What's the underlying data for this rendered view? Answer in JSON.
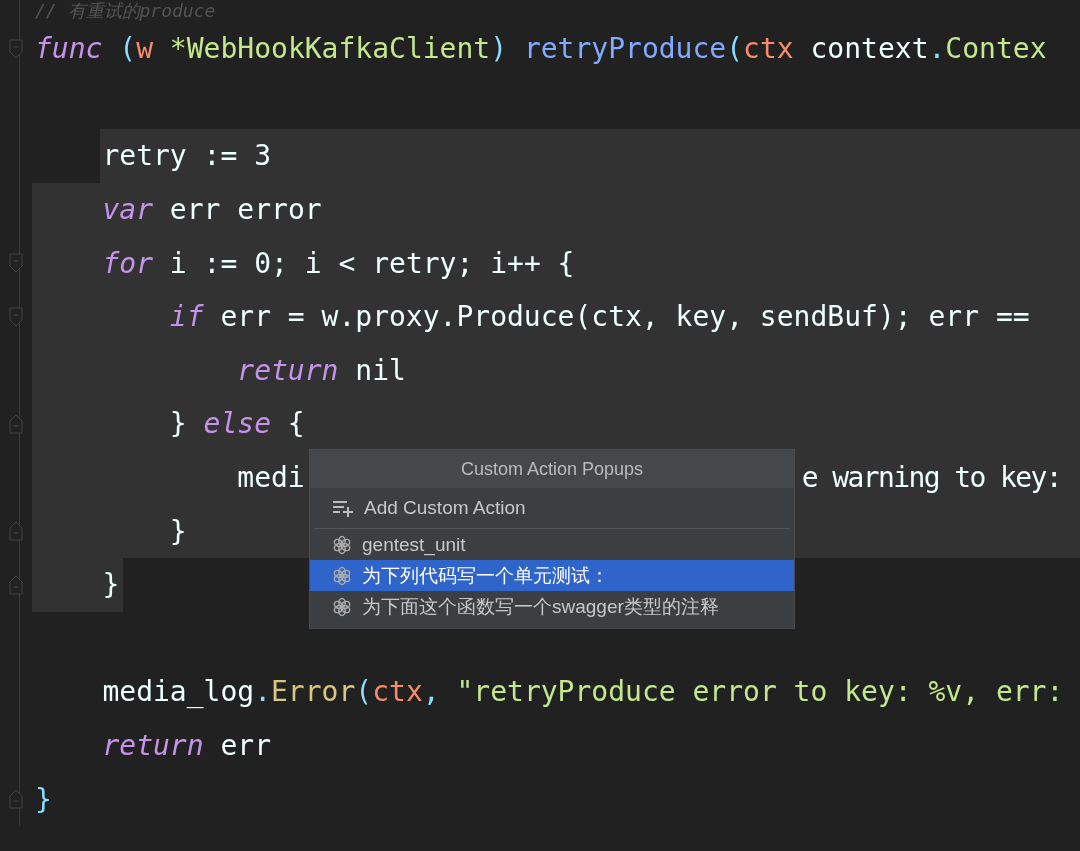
{
  "editor": {
    "lines": [
      {
        "selected": false,
        "tokens": [
          {
            "text": "// 有重试的produce",
            "kind": "comment"
          }
        ]
      },
      {
        "selected": false,
        "fold": {
          "kind": "start"
        },
        "tokens": [
          {
            "text": "func",
            "kind": "keyword"
          },
          {
            "text": " (",
            "kind": "punct"
          },
          {
            "text": "w",
            "kind": "param"
          },
          {
            "text": " *WebHookKafkaClient",
            "kind": "type"
          },
          {
            "text": ") ",
            "kind": "punct"
          },
          {
            "text": "retryProduce",
            "kind": "func"
          },
          {
            "text": "(",
            "kind": "punct"
          },
          {
            "text": "ctx",
            "kind": "param"
          },
          {
            "text": " context",
            "kind": "plain"
          },
          {
            "text": ".",
            "kind": "punct"
          },
          {
            "text": "Contex",
            "kind": "type"
          }
        ]
      },
      {
        "selected": false
      },
      {
        "selected": true,
        "tokens": [
          {
            "text": "    retry := 3",
            "kind": "plain"
          }
        ]
      },
      {
        "selected": true,
        "tokens": [
          {
            "text": "    var",
            "kind": "keyword"
          },
          {
            "text": " err error",
            "kind": "plain"
          }
        ]
      },
      {
        "selected": true,
        "fold": {
          "kind": "start"
        },
        "tokens": [
          {
            "text": "    for",
            "kind": "keyword"
          },
          {
            "text": " i := 0; i < retry; i++ {",
            "kind": "plain"
          }
        ]
      },
      {
        "selected": true,
        "fold": {
          "kind": "start"
        },
        "tokens": [
          {
            "text": "        if",
            "kind": "keyword"
          },
          {
            "text": " err = w.proxy.Produce(ctx, key, sendBuf); err ==",
            "kind": "plain"
          }
        ]
      },
      {
        "selected": true,
        "tokens": [
          {
            "text": "            return",
            "kind": "keyword"
          },
          {
            "text": " nil",
            "kind": "plain"
          }
        ]
      },
      {
        "selected": true,
        "fold": {
          "kind": "end"
        },
        "tokens": [
          {
            "text": "        } ",
            "kind": "plain"
          },
          {
            "text": "else",
            "kind": "keyword"
          },
          {
            "text": " {",
            "kind": "plain"
          }
        ]
      },
      {
        "selected": true,
        "tokens": [
          {
            "text": "            medi",
            "kind": "plain"
          },
          {
            "text": "e warning to key:",
            "kind": "covered_tail"
          }
        ]
      },
      {
        "selected": true,
        "fold": {
          "kind": "end"
        },
        "tokens": [
          {
            "text": "        }",
            "kind": "plain"
          }
        ]
      },
      {
        "selected": true,
        "fold": {
          "kind": "end"
        },
        "tokens": [
          {
            "text": "    }",
            "kind": "plain"
          }
        ]
      },
      {
        "selected": false
      },
      {
        "selected": false,
        "tokens": [
          {
            "text": "    media_log",
            "kind": "plain"
          },
          {
            "text": ".",
            "kind": "punct"
          },
          {
            "text": "Error",
            "kind": "method"
          },
          {
            "text": "(",
            "kind": "punct"
          },
          {
            "text": "ctx",
            "kind": "param"
          },
          {
            "text": ", ",
            "kind": "punct"
          },
          {
            "text": "\"retryProduce error to key: %v, err:",
            "kind": "string"
          }
        ]
      },
      {
        "selected": false,
        "tokens": [
          {
            "text": "    return",
            "kind": "keyword"
          },
          {
            "text": " err",
            "kind": "plain"
          }
        ]
      },
      {
        "selected": false,
        "fold": {
          "kind": "end"
        },
        "tokens": [
          {
            "text": "}",
            "kind": "punct"
          }
        ]
      }
    ]
  },
  "popup": {
    "title": "Custom Action Popups",
    "add_action": {
      "label": "Add Custom Action"
    },
    "items": [
      {
        "label": "gentest_unit",
        "selected": false
      },
      {
        "label": "为下列代码写一个单元测试：",
        "selected": true
      },
      {
        "label": "为下面这个函数写一个swagger类型的注释",
        "selected": false
      }
    ]
  }
}
